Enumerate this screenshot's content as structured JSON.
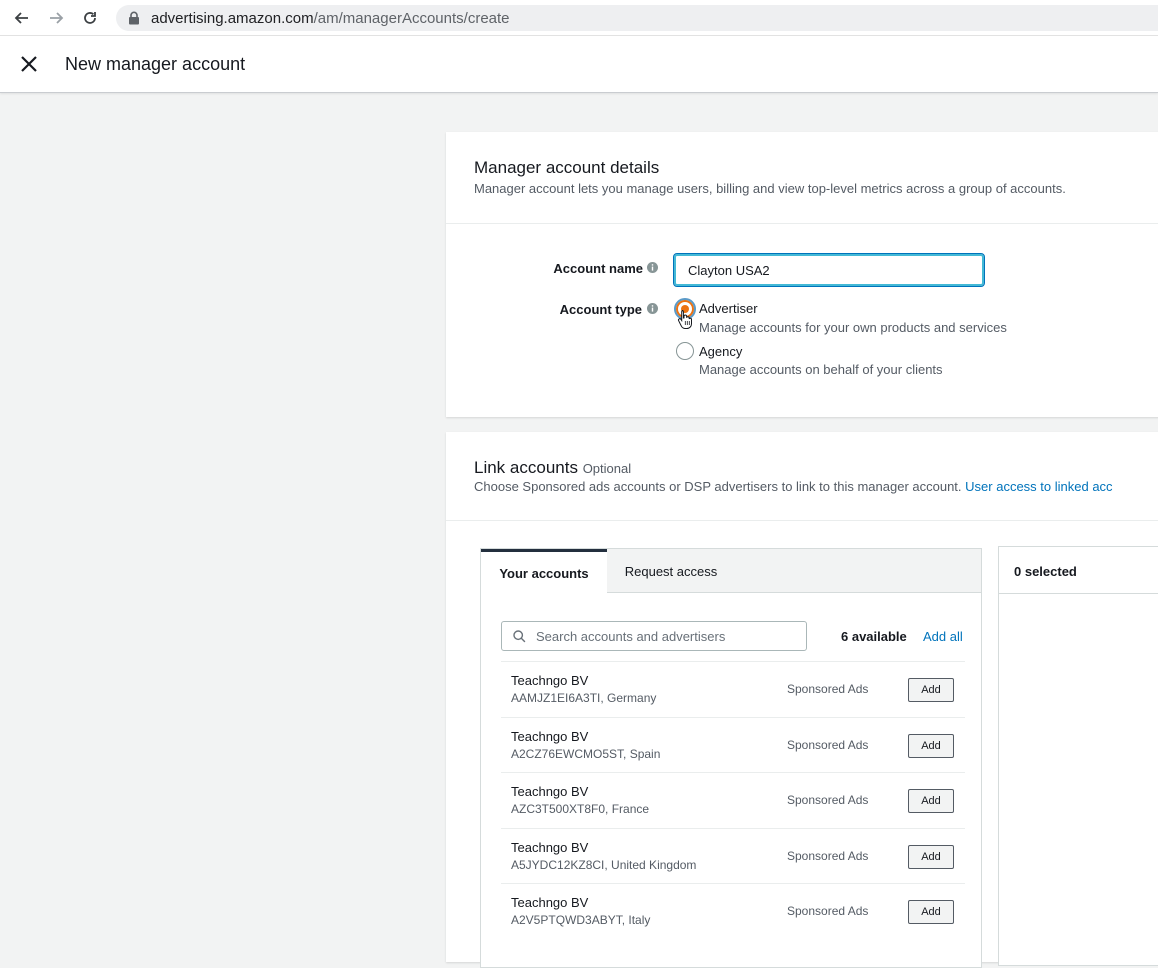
{
  "browser": {
    "url_host": "advertising.amazon.com",
    "url_path": "/am/managerAccounts/create"
  },
  "header": {
    "title": "New manager account"
  },
  "details": {
    "title": "Manager account details",
    "description": "Manager account lets you manage users, billing and view top-level metrics across a group of accounts.",
    "account_name_label": "Account name",
    "account_name_value": "Clayton USA2",
    "account_type_label": "Account type",
    "options": [
      {
        "label": "Advertiser",
        "description": "Manage accounts for your own products and services",
        "selected": true
      },
      {
        "label": "Agency",
        "description": "Manage accounts on behalf of your clients",
        "selected": false
      }
    ]
  },
  "link": {
    "title": "Link accounts",
    "optional": "Optional",
    "description": "Choose Sponsored ads accounts or DSP advertisers to link to this manager account.",
    "link_text": "User access to linked acc",
    "tabs": [
      {
        "label": "Your accounts"
      },
      {
        "label": "Request access"
      }
    ],
    "search_placeholder": "Search accounts and advertisers",
    "available": "6 available",
    "add_all": "Add all",
    "selected": "0 selected",
    "add_label": "Add",
    "rows": [
      {
        "name": "Teachngo BV",
        "sub": "AAMJZ1EI6A3TI, Germany",
        "type": "Sponsored Ads"
      },
      {
        "name": "Teachngo BV",
        "sub": "A2CZ76EWCMO5ST, Spain",
        "type": "Sponsored Ads"
      },
      {
        "name": "Teachngo BV",
        "sub": "AZC3T500XT8F0, France",
        "type": "Sponsored Ads"
      },
      {
        "name": "Teachngo BV",
        "sub": "A5JYDC12KZ8CI, United Kingdom",
        "type": "Sponsored Ads"
      },
      {
        "name": "Teachngo BV",
        "sub": "A2V5PTQWD3ABYT, Italy",
        "type": "Sponsored Ads"
      }
    ]
  },
  "colors": {
    "accent_orange": "#ec7211",
    "link_blue": "#0073bb",
    "focus_blue": "#44b9d6"
  }
}
